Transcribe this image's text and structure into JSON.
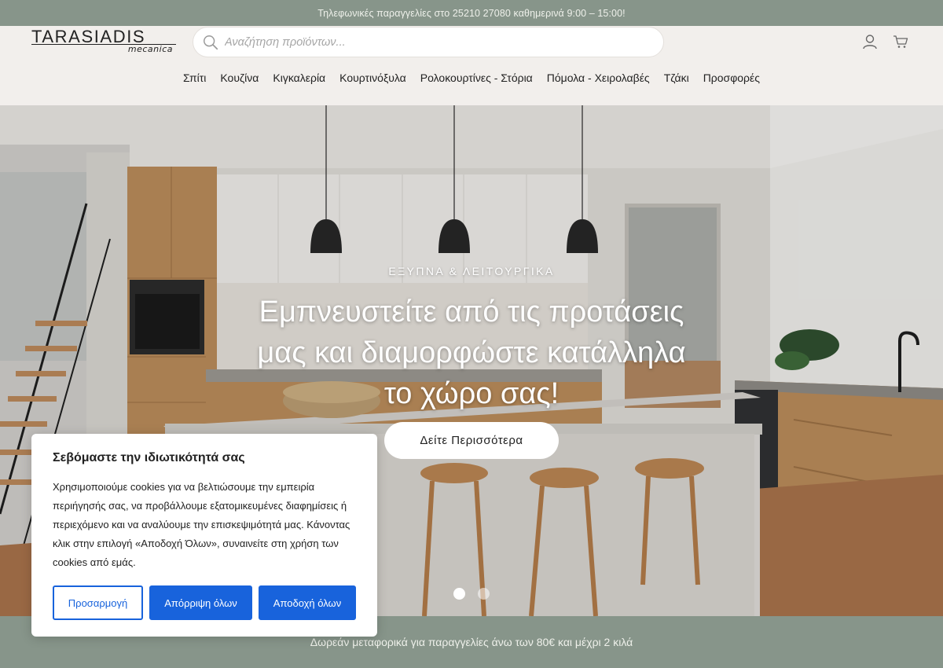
{
  "topbar": {
    "text": "Τηλεφωνικές παραγγελίες στο 25210 27080 καθημερινά 9:00 – 15:00!"
  },
  "logo": {
    "name": "TARASIADIS",
    "sub": "mecanica"
  },
  "search": {
    "placeholder": "Αναζήτηση προϊόντων..."
  },
  "header_icons": {
    "account": "user-icon",
    "cart": "cart-icon"
  },
  "nav": [
    "Σπίτι",
    "Κουζίνα",
    "Κιγκαλερία",
    "Κουρτινόξυλα",
    "Ρολοκουρτίνες - Στόρια",
    "Πόμολα - Χειρολαβές",
    "Τζάκι",
    "Προσφορές"
  ],
  "hero": {
    "kicker": "ΕΞΥΠΝΑ & ΛΕΙΤΟΥΡΓΙΚΑ",
    "title_line1": "Εμπνευστείτε από τις προτάσεις",
    "title_line2": "μας και διαμορφώστε κατάλληλα",
    "title_line3": "το χώρο σας!",
    "button": "Δείτε Περισσότερα",
    "slides_total": 2,
    "slide_active": 1
  },
  "bottombar": {
    "text": "Δωρεάν μεταφορικά για παραγγελίες άνω των 80€ και μέχρι 2 κιλά"
  },
  "cookie": {
    "title": "Σεβόμαστε την ιδιωτικότητά σας",
    "body": "Χρησιμοποιούμε cookies για να βελτιώσουμε την εμπειρία περιήγησής σας, να προβάλλουμε εξατομικευμένες διαφημίσεις ή περιεχόμενο και να αναλύουμε την επισκεψιμότητά μας. Κάνοντας κλικ στην επιλογή «Αποδοχή Όλων», συναινείτε στη χρήση των cookies από εμάς.",
    "customize": "Προσαρμογή",
    "reject": "Απόρριψη όλων",
    "accept": "Αποδοχή όλων"
  },
  "colors": {
    "band": "#87958a",
    "primary": "#1863dc",
    "header_bg": "#f2efec"
  }
}
